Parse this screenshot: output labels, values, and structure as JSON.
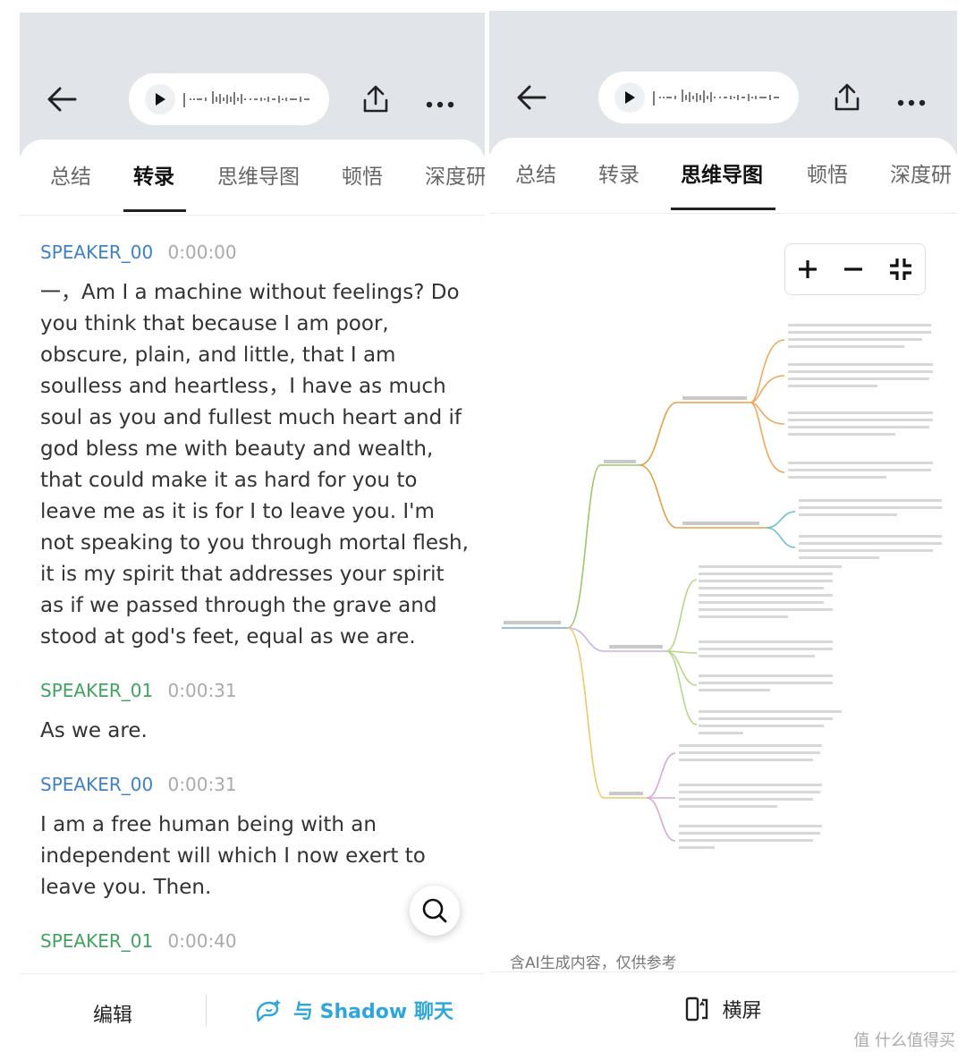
{
  "left": {
    "tabs": [
      "总结",
      "转录",
      "思维导图",
      "顿悟",
      "深度研"
    ],
    "active_tab": 1,
    "transcript": [
      {
        "speaker": "SPEAKER_00",
        "time": "0:00:00",
        "text": "一，Am I a machine without feelings? Do you think that because I am poor, obscure, plain, and little, that I am soulless and heartless，I have as much soul as you and fullest much heart and if god bless me with beauty and wealth, that could make it as hard for you to leave me as it is for I to leave you. I'm not speaking to you through mortal flesh, it is my spirit that addresses your spirit as if we passed through the grave and stood at god's feet, equal as we are."
      },
      {
        "speaker": "SPEAKER_01",
        "time": "0:00:31",
        "text": "As we are."
      },
      {
        "speaker": "SPEAKER_00",
        "time": "0:00:31",
        "text": "I am a free human being with an independent will which I now exert to leave you. Then."
      },
      {
        "speaker": "SPEAKER_01",
        "time": "0:00:40",
        "text": ""
      }
    ],
    "bottom": {
      "edit": "编辑",
      "chat": "与 Shadow 聊天"
    }
  },
  "right": {
    "tabs": [
      "总结",
      "转录",
      "思维导图",
      "顿悟",
      "深度研"
    ],
    "active_tab": 2,
    "disclaimer": "含AI生成内容，仅供参考",
    "rotate": "横屏"
  },
  "colors": {
    "speaker0": "#3d82c6",
    "speaker1": "#3fa35f",
    "chat_accent": "#2ea6d9"
  },
  "watermark": "值 什么值得买"
}
